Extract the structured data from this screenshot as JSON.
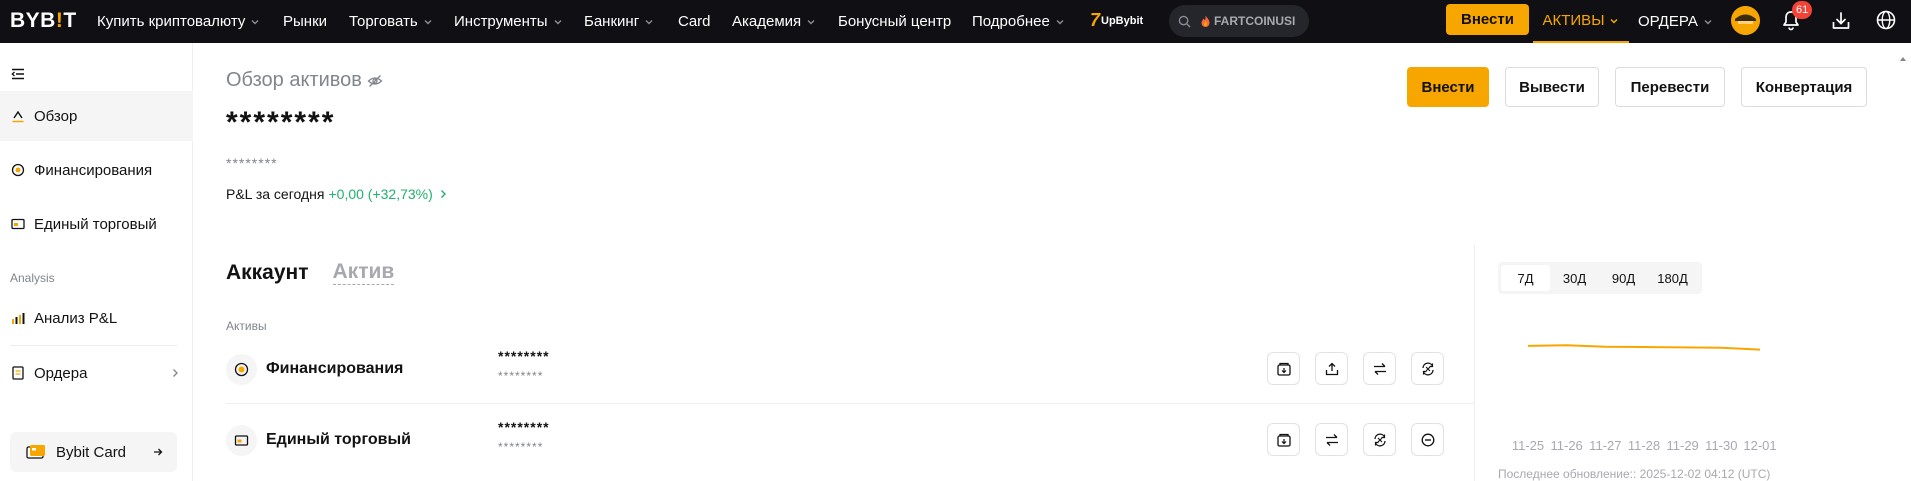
{
  "topbar": {
    "logo": {
      "left": "BYB",
      "dot": "!",
      "right": "T"
    },
    "nav": [
      {
        "label": "Купить криптовалюту",
        "has_menu": true
      },
      {
        "label": "Рынки",
        "has_menu": false
      },
      {
        "label": "Торговать",
        "has_menu": true
      },
      {
        "label": "Инструменты",
        "has_menu": true
      },
      {
        "label": "Банкинг",
        "has_menu": true
      },
      {
        "label": "Card",
        "has_menu": false
      },
      {
        "label": "Академия",
        "has_menu": true
      },
      {
        "label": "Бонусный центр",
        "has_menu": false
      },
      {
        "label": "Подробнее",
        "has_menu": true
      }
    ],
    "upbybit": {
      "seven": "7",
      "label": "UpBybit"
    },
    "search": {
      "value": "FARTCOINUSI",
      "icon": "search-icon"
    },
    "deposit_label": "Внести",
    "assets_label": "АКТИВЫ",
    "orders_label": "ОРДЕРА",
    "notifications_count": "61",
    "accent": "#f7a600"
  },
  "sidebar": {
    "items": [
      {
        "label": "Обзор",
        "icon": "overview-icon",
        "active": true
      },
      {
        "label": "Финансирования",
        "icon": "funding-icon",
        "active": false
      },
      {
        "label": "Единый торговый",
        "icon": "unified-trading-icon",
        "active": false
      }
    ],
    "section_label": "Analysis",
    "analysis_items": [
      {
        "label": "Анализ P&L",
        "icon": "pnl-chart-icon"
      },
      {
        "label": "Ордера",
        "icon": "orders-icon"
      }
    ],
    "card_label": "Bybit Card"
  },
  "overview": {
    "title": "Обзор активов",
    "balance": "********",
    "balance_sub": "********",
    "pnl_label": "P&L за сегодня",
    "pnl_value": "+0,00 (+32,73%)",
    "buttons": {
      "deposit": "Внести",
      "withdraw": "Вывести",
      "transfer": "Перевести",
      "convert": "Конвертация"
    }
  },
  "tabs": {
    "account": "Аккаунт",
    "asset": "Актив"
  },
  "assets": {
    "label": "Активы",
    "rows": [
      {
        "name": "Финансирования",
        "amount": "********",
        "amount_sub": "********",
        "icon": "funding-icon",
        "actions": [
          "deposit-icon",
          "withdraw-icon",
          "transfer-icon",
          "convert-icon"
        ]
      },
      {
        "name": "Единый торговый",
        "amount": "********",
        "amount_sub": "********",
        "icon": "unified-trading-icon",
        "actions": [
          "deposit-icon",
          "transfer-icon",
          "convert-icon",
          "more-icon"
        ]
      }
    ]
  },
  "chart": {
    "ranges": [
      "7Д",
      "30Д",
      "90Д",
      "180Д"
    ],
    "active_range": "7Д",
    "last_update": "Последнее обновление:: 2025-12-02 04:12 (UTC)",
    "color": "#f7a600"
  },
  "chart_data": {
    "type": "line",
    "categories": [
      "11-25",
      "11-26",
      "11-27",
      "11-28",
      "11-29",
      "11-30",
      "12-01"
    ],
    "series": [
      {
        "values": [
          1.0,
          1.01,
          0.99,
          0.985,
          0.98,
          0.975,
          0.95
        ]
      }
    ],
    "xlabel": "",
    "ylabel": "",
    "grid": false
  }
}
